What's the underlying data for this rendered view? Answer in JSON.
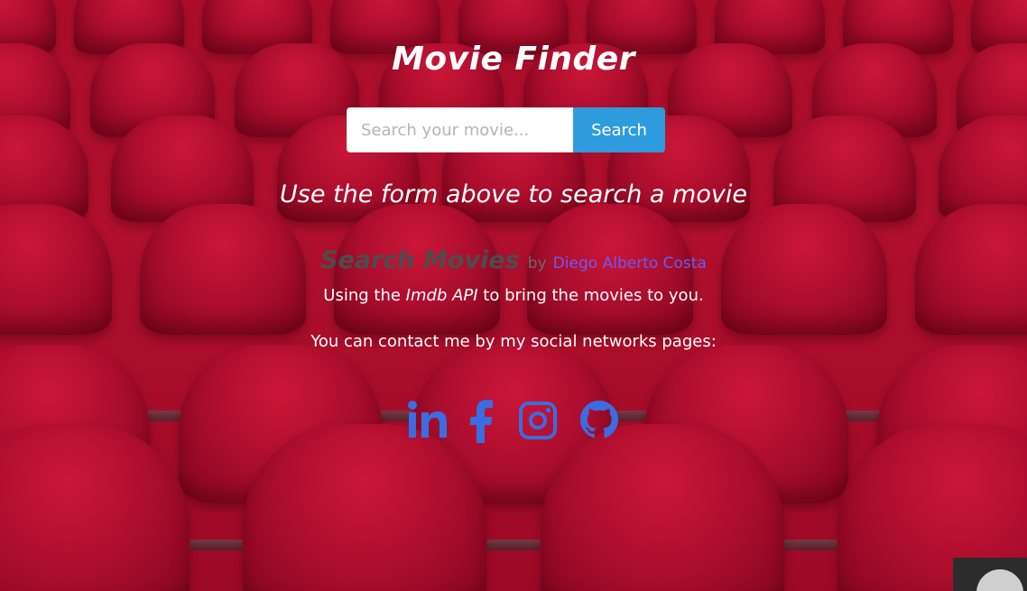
{
  "header": {
    "title": "Movie Finder"
  },
  "search": {
    "placeholder": "Search your movie...",
    "value": "",
    "button_label": "Search"
  },
  "main": {
    "hint": "Use the form above to search a movie"
  },
  "footer": {
    "brand": "Search Movies",
    "by": "by",
    "author": "Diego Alberto Costa",
    "api_prefix": "Using the ",
    "api_name": "Imdb API",
    "api_suffix": " to bring the movies to you.",
    "contact_text": "You can contact me by my social networks pages:",
    "socials": [
      {
        "name": "LinkedIn",
        "icon": "linkedin-icon"
      },
      {
        "name": "Facebook",
        "icon": "facebook-icon"
      },
      {
        "name": "Instagram",
        "icon": "instagram-icon"
      },
      {
        "name": "GitHub",
        "icon": "github-icon"
      }
    ]
  },
  "colors": {
    "background_red": "#b0102c",
    "search_button": "#2e9bdc",
    "icon_blue": "#3a6ee0",
    "author_link": "#6a5cf5",
    "brand_gray": "#4d4d4d"
  }
}
